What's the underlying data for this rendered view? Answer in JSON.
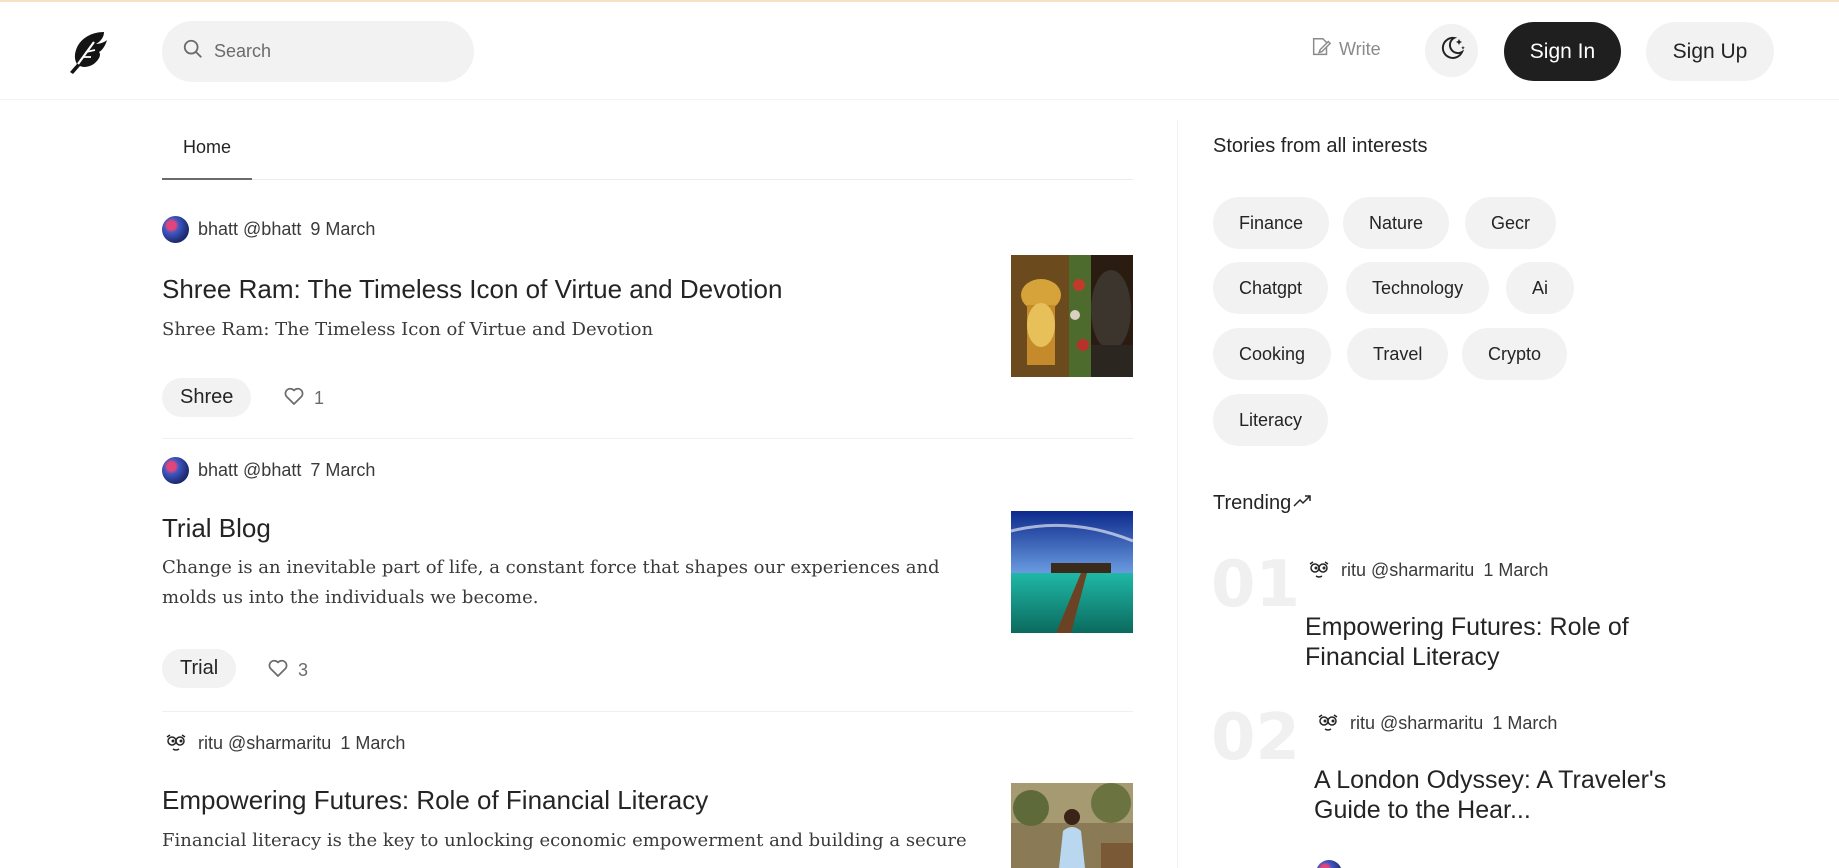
{
  "header": {
    "search_placeholder": "Search",
    "write_label": "Write",
    "sign_in_label": "Sign In",
    "sign_up_label": "Sign Up",
    "icons": {
      "logo": "feather-logo-icon",
      "search": "search-icon",
      "write": "edit-icon",
      "theme": "moon-stars-icon"
    }
  },
  "tabs": [
    {
      "label": "Home"
    }
  ],
  "posts": [
    {
      "author": "bhatt @bhatt",
      "date": "9 March",
      "title": "Shree Ram: The Timeless Icon of Virtue and Devotion",
      "excerpt": "Shree Ram: The Timeless Icon of Virtue and Devotion",
      "tag": "Shree",
      "likes": "1"
    },
    {
      "author": "bhatt @bhatt",
      "date": "7 March",
      "title": "Trial Blog",
      "excerpt": "Change is an inevitable part of life, a constant force that shapes our experiences and molds us into the individuals we become.",
      "tag": "Trial",
      "likes": "3"
    },
    {
      "author": "ritu @sharmaritu",
      "date": "1 March",
      "title": "Empowering Futures: Role of Financial Literacy",
      "excerpt": "Financial literacy is the key to unlocking economic empowerment and building a secure"
    }
  ],
  "sidebar": {
    "interests_title": "Stories from all interests",
    "topics": [
      "Finance",
      "Nature",
      "Gecr",
      "Chatgpt",
      "Technology",
      "Ai",
      "Cooking",
      "Travel",
      "Crypto",
      "Literacy"
    ],
    "trending_title": "Trending",
    "trending": [
      {
        "rank": "01",
        "author": "ritu @sharmaritu",
        "date": "1 March",
        "title": "Empowering Futures: Role of Financial Literacy"
      },
      {
        "rank": "02",
        "author": "ritu @sharmaritu",
        "date": "1 March",
        "title": "A London Odyssey: A Traveler's Guide to the Hear..."
      }
    ]
  },
  "colors": {
    "primary_button": "#1f1f1f",
    "pill_background": "#f2f2f2",
    "text": "#242424",
    "muted": "#6b6b6b"
  }
}
